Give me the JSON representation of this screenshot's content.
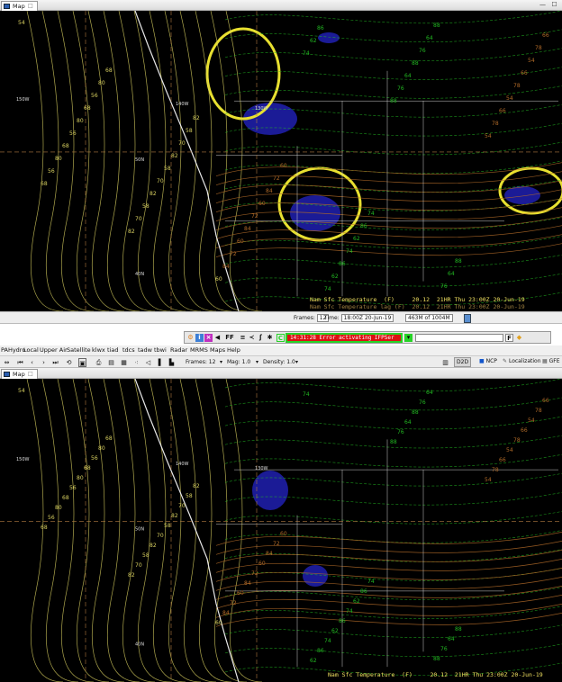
{
  "top_pane": {
    "tab_label": "Map",
    "legend": {
      "line1": "Nam Sfc Temperature  (F)     20.12  21HR Thu 23:00Z 20-Jun-19",
      "line2": "Nam Sfc Temperature lag (F)  20.12  21HR Thu 23:00Z 20-Jun-19"
    }
  },
  "status_bar": {
    "frames_label": "Frames:",
    "frames_value": "12",
    "time_label": "Time:",
    "time_value": "18:00Z 20-Jun-19",
    "memory": "463M of 1004M"
  },
  "float_toolbar": {
    "ff_label": "FF",
    "error_text": "14:31:28 Error activating IFPSer",
    "c_label": "C"
  },
  "menu": [
    "PAHydro",
    "Local",
    "Upper Air",
    "Satellite",
    "klwx",
    "tiad",
    "tdcs",
    "tadw",
    "tbwi",
    "Radar",
    "MRMS",
    "Maps",
    "Help"
  ],
  "toolbar": {
    "frames_text": "Frames: 12",
    "mag_text": "Mag: 1.0",
    "density_text": "Density: 1.0",
    "perspectives": [
      "D2D",
      "NCP",
      "Localization",
      "GFE"
    ]
  },
  "bottom_pane": {
    "tab_label": "Map",
    "legend": "Nam Sfc Temperature  (F)     20.12  21HR Thu 23:00Z 20-Jun-19"
  },
  "map_labels": {
    "longitudes": [
      "150W",
      "140W",
      "130W"
    ],
    "latitudes": [
      "50N",
      "40N"
    ],
    "contour_values": [
      "54",
      "56",
      "58",
      "60",
      "62",
      "64",
      "66",
      "68",
      "70",
      "72",
      "74",
      "76",
      "78",
      "80",
      "82",
      "84",
      "86",
      "88"
    ]
  },
  "colors": {
    "accent_green": "#27d327",
    "error_red": "#d11111",
    "contour_yellow": "#d8d060",
    "contour_green": "#22b822",
    "contour_brown": "#b06a28",
    "cold_blue": "#2020b0"
  }
}
